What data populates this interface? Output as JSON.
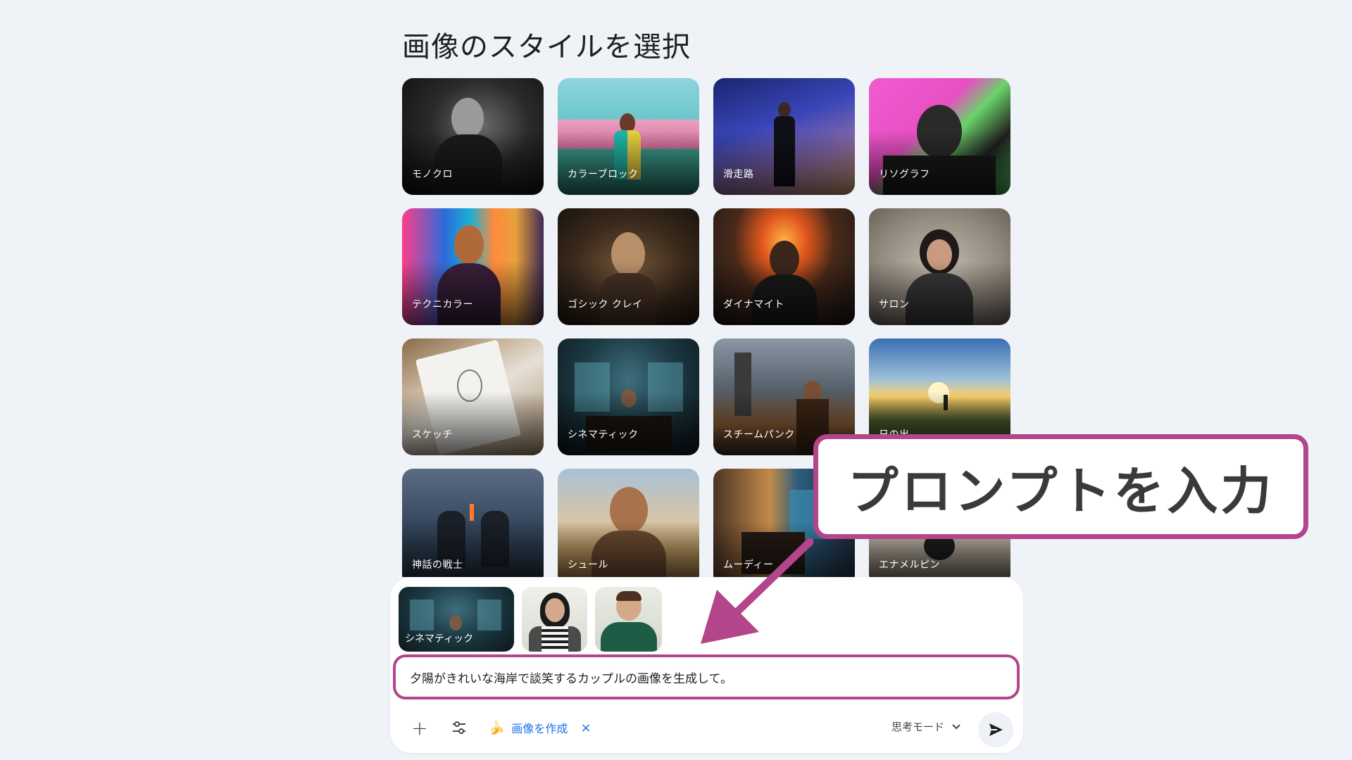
{
  "page": {
    "title": "画像のスタイルを選択"
  },
  "styles": [
    {
      "label": "モノクロ",
      "icon": "monochrome-portrait"
    },
    {
      "label": "カラーブロック",
      "icon": "color-block-room"
    },
    {
      "label": "滑走路",
      "icon": "runway-model"
    },
    {
      "label": "リソグラフ",
      "icon": "risograph-poster"
    },
    {
      "label": "テクニカラー",
      "icon": "technicolor-portrait"
    },
    {
      "label": "ゴシック クレイ",
      "icon": "gothic-clay-figure"
    },
    {
      "label": "ダイナマイト",
      "icon": "explosion-portrait"
    },
    {
      "label": "サロン",
      "icon": "salon-portrait"
    },
    {
      "label": "スケッチ",
      "icon": "pencil-sketch"
    },
    {
      "label": "シネマティック",
      "icon": "cinematic-room"
    },
    {
      "label": "スチームパンク",
      "icon": "steampunk-city"
    },
    {
      "label": "日の出",
      "icon": "sunrise-field"
    },
    {
      "label": "神話の戦士",
      "icon": "warriors-battle"
    },
    {
      "label": "シュール",
      "icon": "surreal-portrait"
    },
    {
      "label": "ムーディー",
      "icon": "moody-room"
    },
    {
      "label": "エナメルピン",
      "icon": "enamel-pin"
    }
  ],
  "composer": {
    "attachments": [
      {
        "type": "style",
        "label": "シネマティック"
      },
      {
        "type": "reference-photo",
        "label": ""
      },
      {
        "type": "reference-photo",
        "label": ""
      }
    ],
    "prompt_text": "夕陽がきれいな海岸で談笑するカップルの画像を生成して。",
    "plus_label": "+",
    "tool_chip_label": "画像を作成",
    "tool_chip_close": "×",
    "mode_label": "思考モード"
  },
  "callout": {
    "text": "プロンプトを入力",
    "border_color": "#b3458a"
  }
}
